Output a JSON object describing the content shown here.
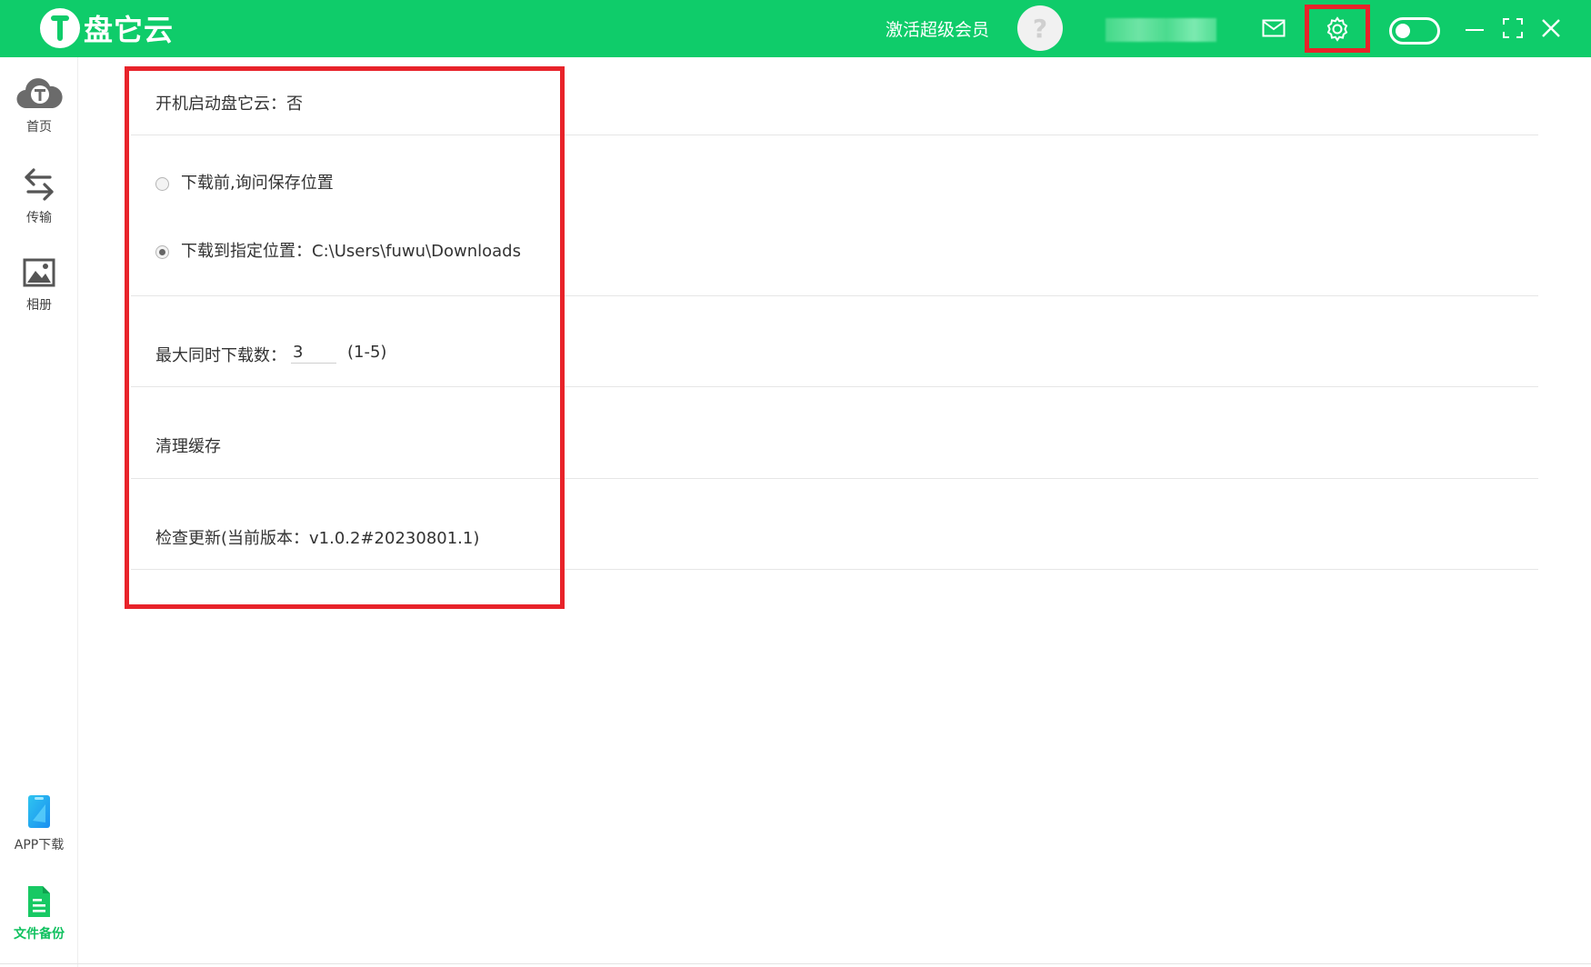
{
  "titlebar": {
    "app_name": "盘它云",
    "vip_label": "激活超级会员",
    "avatar_glyph": "?"
  },
  "sidebar": {
    "items": [
      {
        "label": "首页",
        "icon": "cloud-icon"
      },
      {
        "label": "传输",
        "icon": "transfer-arrows-icon"
      },
      {
        "label": "相册",
        "icon": "image-icon"
      },
      {
        "label": "APP下载",
        "icon": "phone-icon"
      },
      {
        "label": "文件备份",
        "icon": "document-icon"
      }
    ],
    "active_index": 4
  },
  "settings": {
    "autostart": "开机启动盘它云：否",
    "download_location": {
      "option_ask": "下载前,询问保存位置",
      "option_fixed": "下载到指定位置：C:\\Users\\fuwu\\Downloads",
      "selected": "option_fixed"
    },
    "max_downloads": {
      "label": "最大同时下载数：",
      "value": "3",
      "range": "(1-5)"
    },
    "clear_cache": "清理缓存",
    "check_update": "检查更新(当前版本：v1.0.2#20230801.1)"
  },
  "colors": {
    "brand_green": "#0fcc6a",
    "highlight_red": "#e8232a"
  }
}
